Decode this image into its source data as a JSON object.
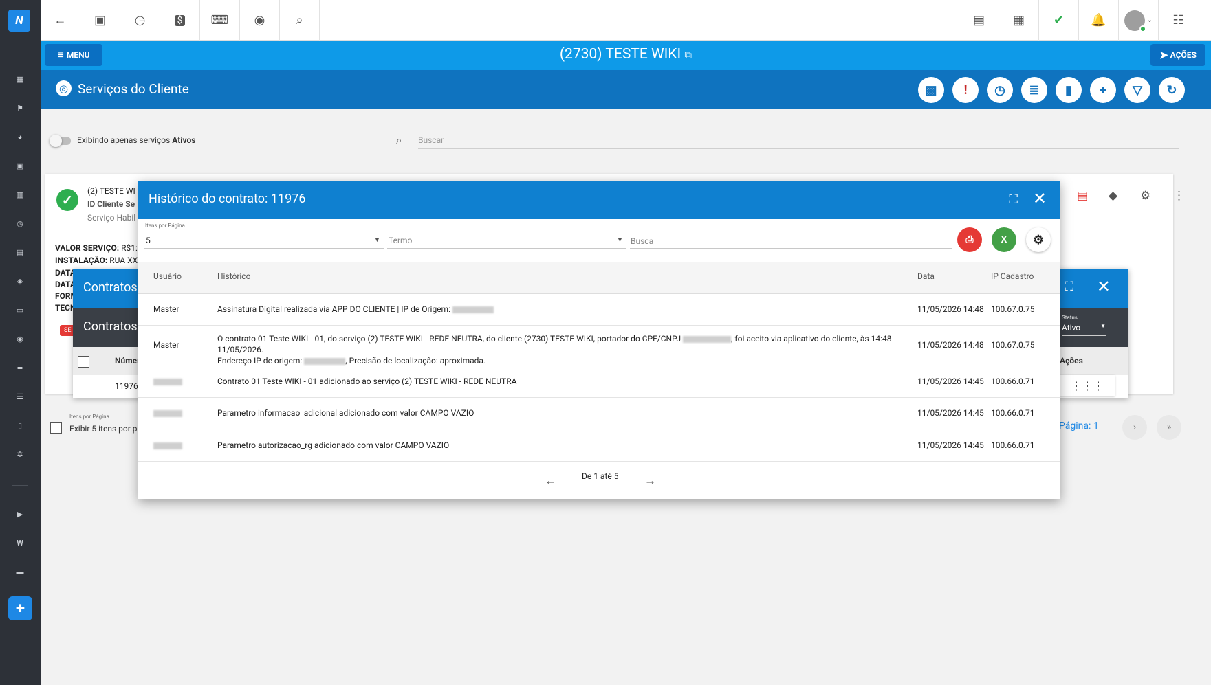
{
  "rail_icons": [
    "dashboard-icon",
    "map-pin-icon",
    "pie-chart-icon",
    "contacts-icon",
    "book-icon",
    "calendar-clock-icon",
    "briefcase-icon",
    "box-icon",
    "cash-icon",
    "location-icon",
    "list-icon",
    "server-icon",
    "document-icon",
    "settings-icon",
    "youtube-icon",
    "wiki-icon",
    "chat-icon",
    "puzzle-icon"
  ],
  "wiki_glyph": "W",
  "topbar": {
    "left_icons": [
      "back-arrow-icon",
      "contact-card-icon",
      "calendar-clock-icon",
      "dollar-icon",
      "terminal-icon",
      "eye-icon",
      "search-icon"
    ],
    "right_icons": [
      "pdf-file-icon",
      "calendar-gift-icon",
      "check-shield-icon",
      "alarm-bell-icon",
      "avatar",
      "menu-list-icon"
    ]
  },
  "bluebar": {
    "menu_label": "MENU",
    "title": "(2730) TESTE WIKI",
    "acoes_label": "AÇÕES"
  },
  "section": {
    "title": "Serviços do Cliente",
    "buttons": [
      "gift-icon",
      "alert-bubble-icon",
      "calendar-clock-icon",
      "list-icon",
      "document-icon",
      "plus-icon",
      "filter-icon",
      "refresh-icon"
    ]
  },
  "filter": {
    "toggle_text_prefix": "Exibindo apenas serviços ",
    "toggle_text_bold": "Ativos",
    "search_placeholder": "Buscar"
  },
  "card": {
    "title": "(2) TESTE WI",
    "id_label": "ID Cliente Se",
    "status_label": "Serviço Habil",
    "valor_label": "VALOR SERVIÇO:",
    "valor_value": "R$1:",
    "instalacao_label": "INSTALAÇÃO:",
    "instalacao_value": "RUA XX",
    "line_data1": "DATA",
    "line_data2": "DATA",
    "line_form": "FORM",
    "line_tec": "TECN",
    "tag": "SE"
  },
  "contratos": {
    "title": "Contratos",
    "subtitle": "Contratos",
    "col_numero": "Númer",
    "col_acoes": "Ações",
    "row_num": "11976",
    "status_label": "Status",
    "status_value": "Ativo",
    "itens_label": "Itens por Página",
    "itens_value": "Exibir 5 itens por pá",
    "pagina": "Página: 1"
  },
  "modal": {
    "title": "Histórico do contrato: 11976",
    "itens_label": "Itens por Página",
    "itens_value": "5",
    "termo_placeholder": "Termo",
    "busca_placeholder": "Busca",
    "headers": [
      "Usuário",
      "Histórico",
      "Data",
      "IP Cadastro"
    ],
    "rows": [
      {
        "usuario": "Master",
        "historico": "Assinatura Digital realizada via APP DO CLIENTE | IP de Origem: ",
        "data": "11/05/2026 14:48",
        "ip": "100.67.0.75"
      },
      {
        "usuario": "Master",
        "historico_a": "O contrato 01 Teste WIKI - 01, do serviço (2) TESTE WIKI - REDE NEUTRA, do cliente (2730) TESTE WIKI, portador do CPF/CNPJ ",
        "historico_b": ", foi aceito via aplicativo do cliente, às 14:48 11/05/2026.",
        "historico_c": "Endereço IP de origem: ",
        "historico_d": ", Precisão de localização: aproximada.",
        "data": "11/05/2026 14:48",
        "ip": "100.67.0.75"
      },
      {
        "usuario": "",
        "historico": "Contrato 01 Teste WIKI - 01 adicionado ao serviço (2) TESTE WIKI - REDE NEUTRA",
        "data": "11/05/2026 14:45",
        "ip": "100.66.0.71"
      },
      {
        "usuario": "",
        "historico": "Parametro informacao_adicional adicionado com valor CAMPO VAZIO",
        "data": "11/05/2026 14:45",
        "ip": "100.66.0.71"
      },
      {
        "usuario": "",
        "historico": "Parametro autorizacao_rg adicionado com valor CAMPO VAZIO",
        "data": "11/05/2026 14:45",
        "ip": "100.66.0.71"
      }
    ],
    "pager_text": "De 1 até 5"
  },
  "colors": {
    "primary": "#0e9ae8",
    "dark_primary": "#0f73bf",
    "pdf_red": "#e53935",
    "excel_green": "#43a047",
    "success": "#2eae4f"
  }
}
